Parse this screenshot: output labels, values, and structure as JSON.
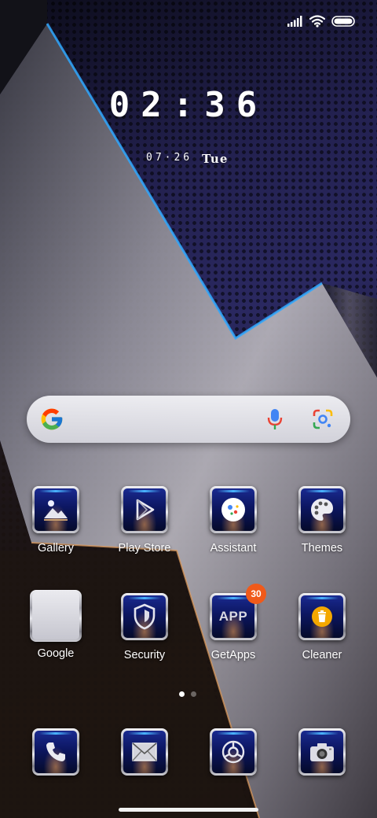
{
  "status_bar": {
    "icons": [
      "signal-icon",
      "wifi-icon",
      "battery-icon"
    ]
  },
  "clock": {
    "time": "02:36",
    "date": "07·26",
    "weekday": "Tue"
  },
  "search_bar": {
    "icons": [
      "google-logo-icon",
      "microphone-icon",
      "google-lens-icon"
    ]
  },
  "apps": [
    {
      "label": "Gallery",
      "icon": "gallery-icon"
    },
    {
      "label": "Play Store",
      "icon": "play-store-icon"
    },
    {
      "label": "Assistant",
      "icon": "assistant-icon"
    },
    {
      "label": "Themes",
      "icon": "themes-palette-icon"
    },
    {
      "label": "Google",
      "icon": "google-folder-icon"
    },
    {
      "label": "Security",
      "icon": "security-shield-icon"
    },
    {
      "label": "GetApps",
      "icon": "getapps-icon",
      "badge": "30",
      "icon_text": "APP"
    },
    {
      "label": "Cleaner",
      "icon": "cleaner-trash-icon"
    }
  ],
  "page_indicator": {
    "pages": 2,
    "current": 1
  },
  "dock": [
    {
      "icon": "phone-icon"
    },
    {
      "icon": "messages-envelope-icon"
    },
    {
      "icon": "browser-icon"
    },
    {
      "icon": "camera-icon"
    }
  ],
  "colors": {
    "badge": "#f05a1a",
    "icon_blue": "#0c1660",
    "accent_glow": "#49b4ff"
  }
}
